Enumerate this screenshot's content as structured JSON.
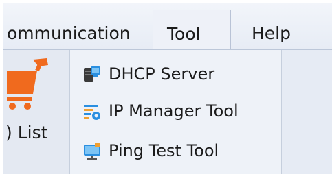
{
  "menubar": {
    "items": [
      {
        "label": "ommunication"
      },
      {
        "label": "Tool"
      },
      {
        "label": "Help"
      }
    ]
  },
  "left_pane": {
    "list_label": ") List",
    "icon": "shopping-cart-icon"
  },
  "dropdown": {
    "items": [
      {
        "label": "DHCP Server",
        "icon": "dhcp-server-icon"
      },
      {
        "label": "IP Manager Tool",
        "icon": "ip-manager-icon"
      },
      {
        "label": "Ping Test Tool",
        "icon": "ping-monitor-icon"
      }
    ]
  },
  "colors": {
    "cart_orange": "#f06a1e",
    "icon_blue": "#2a8fe0",
    "icon_dark": "#3a3a3a"
  }
}
